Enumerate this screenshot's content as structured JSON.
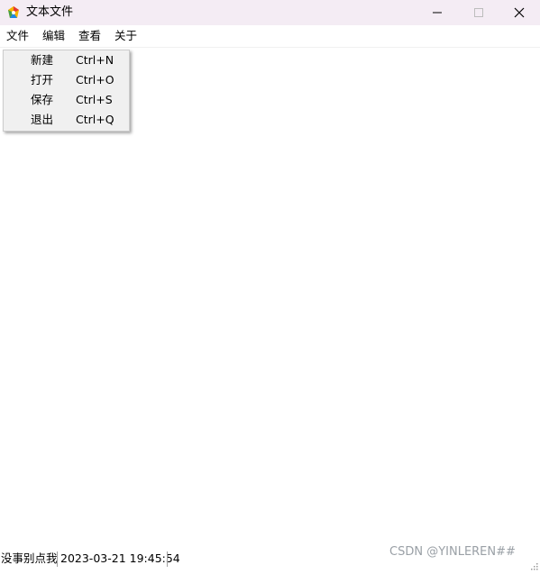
{
  "window": {
    "title": "文本文件",
    "icon": "app-notepad-icon",
    "controls": {
      "minimize_icon": "minimize-icon",
      "maximize_icon": "maximize-icon",
      "close_icon": "close-icon"
    }
  },
  "menubar": {
    "items": [
      {
        "label": "文件"
      },
      {
        "label": "编辑"
      },
      {
        "label": "查看"
      },
      {
        "label": "关于"
      }
    ]
  },
  "file_menu": {
    "open": true,
    "items": [
      {
        "label": "新建",
        "shortcut": "Ctrl+N"
      },
      {
        "label": "打开",
        "shortcut": "Ctrl+O"
      },
      {
        "label": "保存",
        "shortcut": "Ctrl+S"
      },
      {
        "label": "退出",
        "shortcut": "Ctrl+Q"
      }
    ]
  },
  "editor": {
    "content": ""
  },
  "statusbar": {
    "message": "没事别点我",
    "datetime": "2023-03-21 19:45:54"
  },
  "watermark": {
    "text": "CSDN @YINLEREN##"
  },
  "colors": {
    "titlebar_bg": "#f4ecf4",
    "menu_bg": "#f0f0f0",
    "watermark": "#9aa0a6"
  }
}
